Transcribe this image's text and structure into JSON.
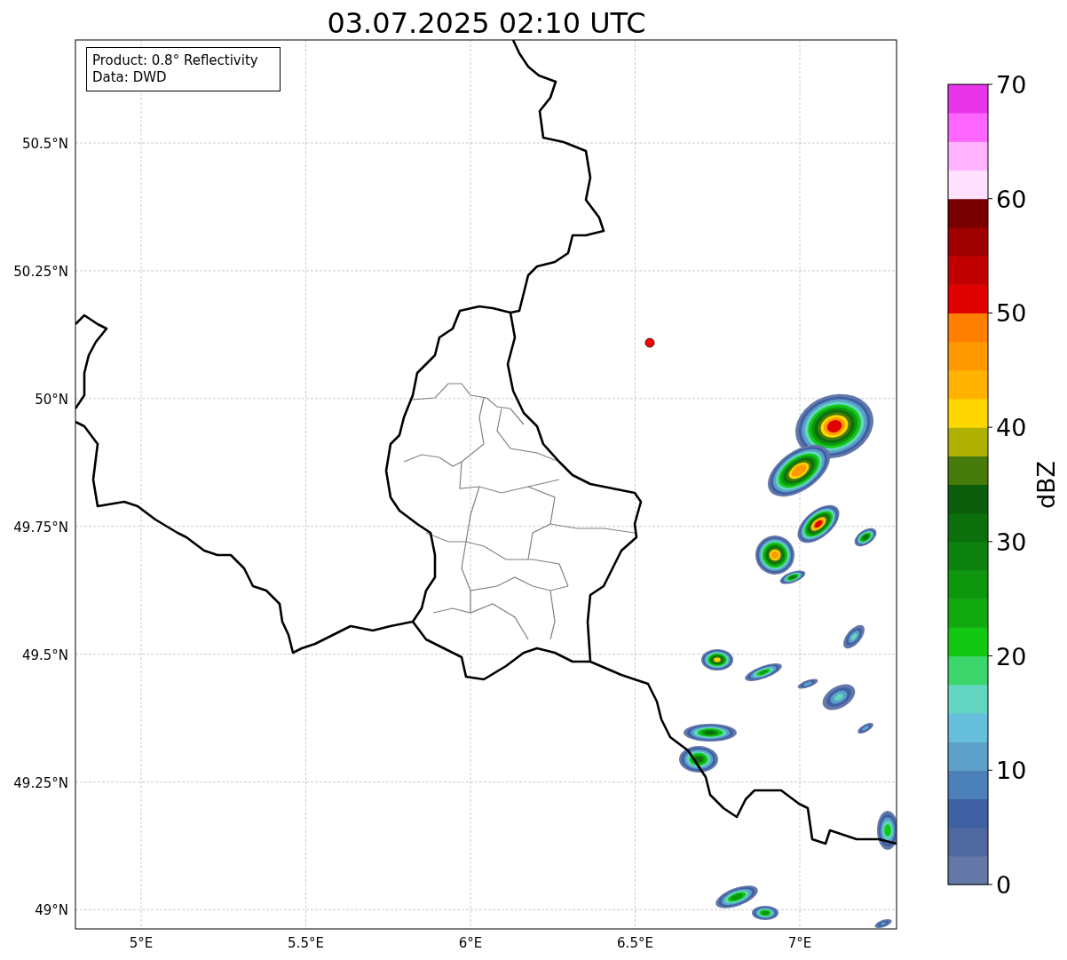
{
  "title": "03.07.2025 02:10 UTC",
  "info_box": {
    "lines": [
      "Product: 0.8° Reflectivity",
      "Data: DWD"
    ]
  },
  "map": {
    "x_tick_labels": [
      "5°E",
      "5.5°E",
      "6°E",
      "6.5°E",
      "7°E"
    ],
    "y_tick_labels": [
      "50.5°N",
      "50.25°N",
      "50°N",
      "49.75°N",
      "49.5°N",
      "49.25°N",
      "49°N"
    ]
  },
  "colorbar": {
    "label": "dBZ",
    "tick_labels": [
      "70",
      "60",
      "50",
      "40",
      "30",
      "20",
      "10",
      "0"
    ],
    "bands": [
      {
        "color": "#6478a8"
      },
      {
        "color": "#5068a0"
      },
      {
        "color": "#4060a4"
      },
      {
        "color": "#4c80b8"
      },
      {
        "color": "#5ca0c8"
      },
      {
        "color": "#66c0dc"
      },
      {
        "color": "#62d6c0"
      },
      {
        "color": "#3cd66c"
      },
      {
        "color": "#12c812"
      },
      {
        "color": "#10aa10"
      },
      {
        "color": "#0e960e"
      },
      {
        "color": "#0e820e"
      },
      {
        "color": "#0b700b"
      },
      {
        "color": "#0b5c0b"
      },
      {
        "color": "#467a0b"
      },
      {
        "color": "#b0b000"
      },
      {
        "color": "#ffd700"
      },
      {
        "color": "#ffb300"
      },
      {
        "color": "#ff9900"
      },
      {
        "color": "#ff7f00"
      },
      {
        "color": "#e00000"
      },
      {
        "color": "#c00000"
      },
      {
        "color": "#a00000"
      },
      {
        "color": "#780000"
      },
      {
        "color": "#ffe0ff"
      },
      {
        "color": "#ffb3ff"
      },
      {
        "color": "#ff66ff"
      },
      {
        "color": "#e935e9"
      }
    ]
  }
}
